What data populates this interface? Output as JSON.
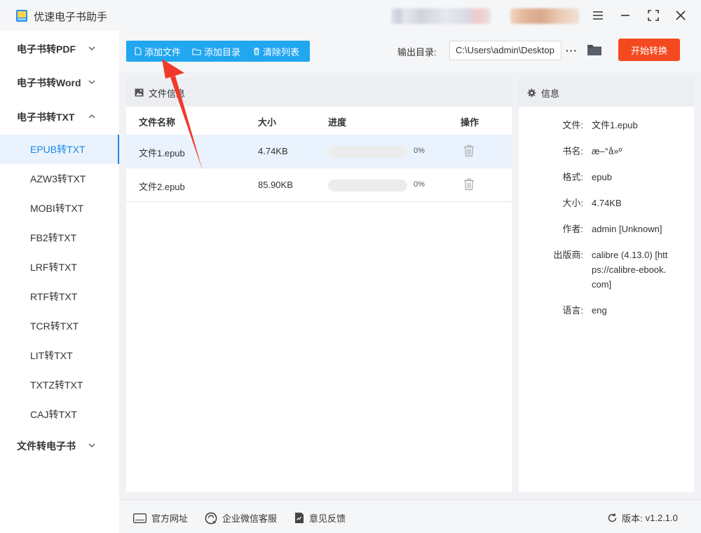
{
  "app": {
    "title": "优速电子书助手"
  },
  "sidebar": {
    "groups": [
      {
        "label": "电子书转PDF",
        "expanded": false
      },
      {
        "label": "电子书转Word",
        "expanded": false
      },
      {
        "label": "电子书转TXT",
        "expanded": true
      },
      {
        "label": "文件转电子书",
        "expanded": false
      }
    ],
    "items": [
      {
        "label": "EPUB转TXT",
        "active": true
      },
      {
        "label": "AZW3转TXT"
      },
      {
        "label": "MOBI转TXT"
      },
      {
        "label": "FB2转TXT"
      },
      {
        "label": "LRF转TXT"
      },
      {
        "label": "RTF转TXT"
      },
      {
        "label": "TCR转TXT"
      },
      {
        "label": "LIT转TXT"
      },
      {
        "label": "TXTZ转TXT"
      },
      {
        "label": "CAJ转TXT"
      }
    ]
  },
  "toolbar": {
    "add_file": "添加文件",
    "add_dir": "添加目录",
    "clear_list": "清除列表",
    "output_label": "输出目录:",
    "output_path": "C:\\Users\\admin\\Desktop",
    "more": "···",
    "start": "开始转换"
  },
  "file_panel": {
    "title": "文件信息",
    "columns": [
      "文件名称",
      "大小",
      "进度",
      "操作"
    ],
    "rows": [
      {
        "name": "文件1.epub",
        "size": "4.74KB",
        "progress": 0,
        "progress_label": "0%",
        "selected": true
      },
      {
        "name": "文件2.epub",
        "size": "85.90KB",
        "progress": 0,
        "progress_label": "0%",
        "selected": false
      }
    ]
  },
  "info_panel": {
    "title": "信息",
    "fields": [
      {
        "label": "文件:",
        "value": "文件1.epub"
      },
      {
        "label": "书名:",
        "value": "æ–°å»º"
      },
      {
        "label": "格式:",
        "value": "epub"
      },
      {
        "label": "大小:",
        "value": "4.74KB"
      },
      {
        "label": "作者:",
        "value": "admin [Unknown]"
      },
      {
        "label": "出版商:",
        "value": "calibre (4.13.0) [https://calibre-ebook.com]"
      },
      {
        "label": "语言:",
        "value": "eng"
      }
    ]
  },
  "footer": {
    "website": "官方网址",
    "wechat": "企业微信客服",
    "feedback": "意见反馈",
    "version_label": "版本:",
    "version": "v1.2.1.0"
  },
  "colors": {
    "accent": "#21a6f0",
    "start_button": "#f4491f",
    "annotation_arrow": "#f0392b"
  }
}
